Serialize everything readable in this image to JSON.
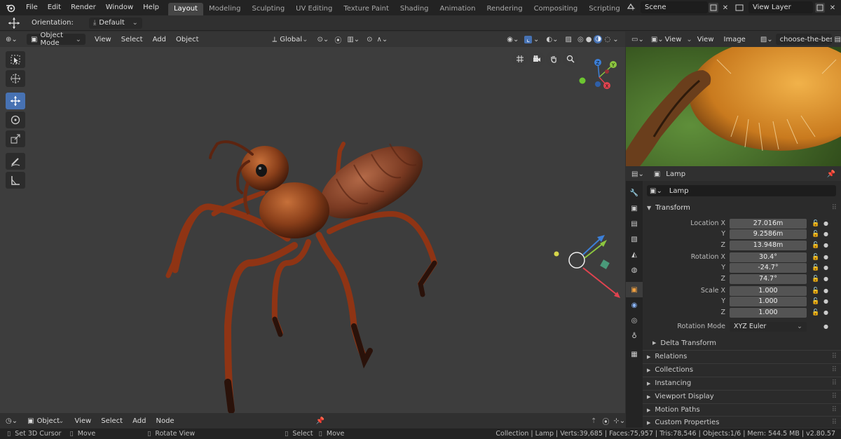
{
  "menu": [
    "File",
    "Edit",
    "Render",
    "Window",
    "Help"
  ],
  "workspace_tabs": [
    "Layout",
    "Modeling",
    "Sculpting",
    "UV Editing",
    "Texture Paint",
    "Shading",
    "Animation",
    "Rendering",
    "Compositing",
    "Scripting"
  ],
  "active_tab": "Layout",
  "scene": {
    "name": "Scene",
    "view_layer": "View Layer"
  },
  "tool_header": {
    "orientation_label": "Orientation:",
    "orientation_value": "Default"
  },
  "viewport": {
    "mode": "Object Mode",
    "menu": [
      "View",
      "Select",
      "Add",
      "Object"
    ],
    "transform_orientation": "Global"
  },
  "image_editor": {
    "menu": [
      "View",
      "View",
      "Image"
    ],
    "image_name": "choose-the-best-an..."
  },
  "properties": {
    "header_object": "Lamp",
    "object_name": "Lamp",
    "transform_title": "Transform",
    "location": {
      "label": "Location X",
      "x": "27.016m",
      "y": "9.2586m",
      "z": "13.948m"
    },
    "rotation": {
      "label": "Rotation X",
      "x": "30.4°",
      "y": "-24.7°",
      "z": "74.7°"
    },
    "scale": {
      "label": "Scale X",
      "x": "1.000",
      "y": "1.000",
      "z": "1.000"
    },
    "axis_y": "Y",
    "axis_z": "Z",
    "rotation_mode_label": "Rotation Mode",
    "rotation_mode_value": "XYZ Euler",
    "delta_transform": "Delta Transform",
    "panels": [
      "Relations",
      "Collections",
      "Instancing",
      "Viewport Display",
      "Motion Paths",
      "Custom Properties"
    ]
  },
  "timeline": {
    "mode": "Object",
    "menu": [
      "View",
      "Select",
      "Add",
      "Node"
    ]
  },
  "status": {
    "left": [
      "Set 3D Cursor",
      "Move",
      "Rotate View",
      "Select",
      "Move"
    ],
    "right": "Collection | Lamp | Verts:39,685 | Faces:75,957 | Tris:78,546 | Objects:1/6 | Mem: 544.5 MB | v2.80.57"
  },
  "colors": {
    "accent": "#4772b3",
    "axis_x": "#e0434f",
    "axis_y": "#8cc63f",
    "axis_z": "#3c7fd8"
  }
}
